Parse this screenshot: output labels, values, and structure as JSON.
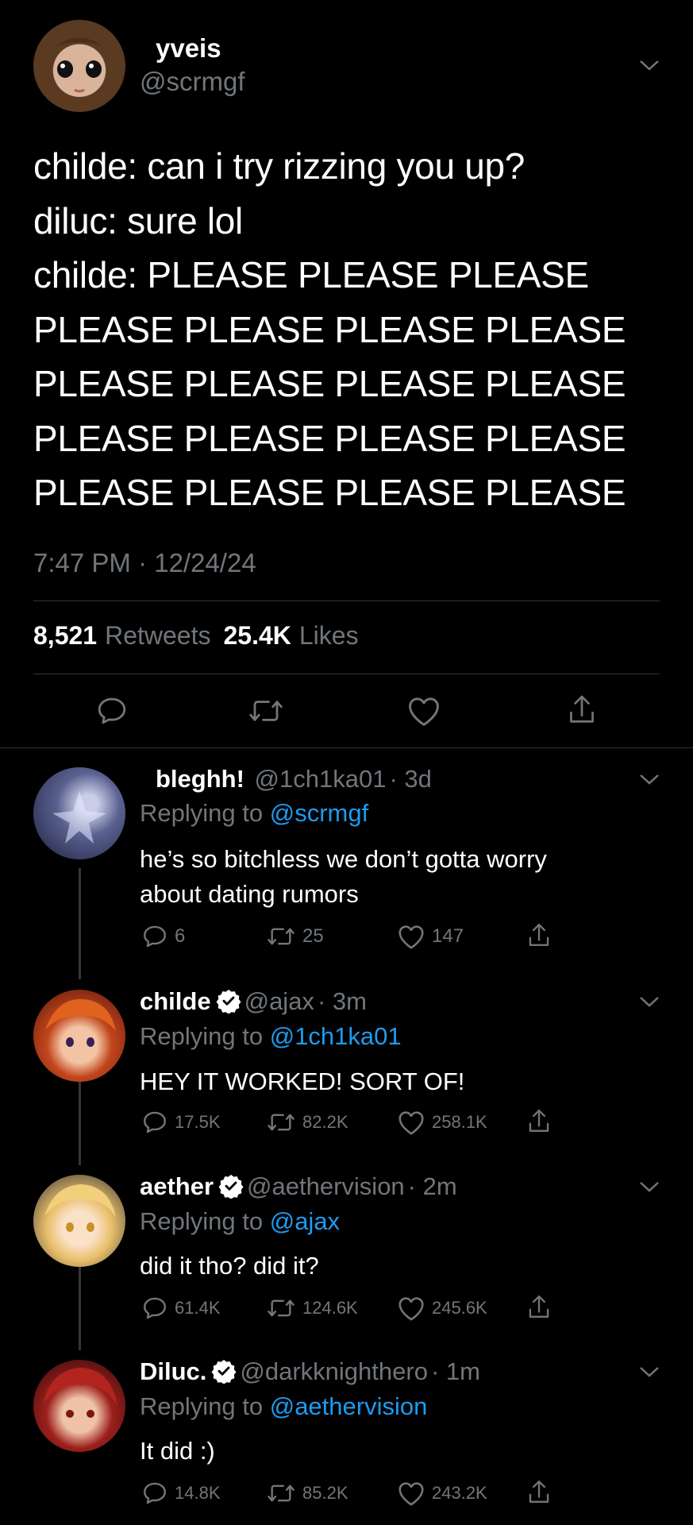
{
  "main_tweet": {
    "name": "yveis",
    "handle": "@scrmgf",
    "lines": [
      "childe: can i try rizzing you up?",
      "diluc: sure lol",
      "childe: PLEASE PLEASE PLEASE",
      "PLEASE PLEASE PLEASE PLEASE",
      "PLEASE PLEASE PLEASE PLEASE",
      "PLEASE PLEASE PLEASE PLEASE",
      "PLEASE PLEASE PLEASE PLEASE"
    ],
    "timestamp": "7:47 PM · 12/24/24",
    "retweets_count": "8,521",
    "retweets_label": "Retweets",
    "likes_count": "25.4K",
    "likes_label": "Likes"
  },
  "replies": [
    {
      "name": "bleghh!",
      "handle": "@1ch1ka01",
      "time": "· 3d",
      "replying_label": "Replying to",
      "replying_to": "@scrmgf",
      "text_lines": [
        "he’s so bitchless we don’t gotta worry",
        "about dating rumors"
      ],
      "replies": "6",
      "retweets": "25",
      "likes": "147",
      "verified": false
    },
    {
      "name": "childe",
      "handle": "@ajax",
      "time": "· 3m",
      "replying_label": "Replying to",
      "replying_to": "@1ch1ka01",
      "text_lines": [
        "HEY IT WORKED! SORT OF!"
      ],
      "replies": "17.5K",
      "retweets": "82.2K",
      "likes": "258.1K",
      "verified": true
    },
    {
      "name": "aether",
      "handle": "@aethervision",
      "time": "· 2m",
      "replying_label": "Replying to",
      "replying_to": "@ajax",
      "text_lines": [
        "did it tho? did it?"
      ],
      "replies": "61.4K",
      "retweets": "124.6K",
      "likes": "245.6K",
      "verified": true
    },
    {
      "name": "Diluc.",
      "handle": "@darkknighthero",
      "time": "· 1m",
      "replying_label": "Replying to",
      "replying_to": "@aethervision",
      "text_lines": [
        "It did :)"
      ],
      "replies": "14.8K",
      "retweets": "85.2K",
      "likes": "243.2K",
      "verified": true
    }
  ],
  "icons": {
    "reply": "speech-bubble-icon",
    "retweet": "retweet-icon",
    "like": "heart-icon",
    "share": "share-icon",
    "more": "chevron-down-icon",
    "verified": "verified-badge-icon"
  },
  "colors": {
    "background": "#000000",
    "text": "#ffffff",
    "secondary": "#71767b",
    "link": "#1d9bf0",
    "divider": "#2f3336"
  }
}
